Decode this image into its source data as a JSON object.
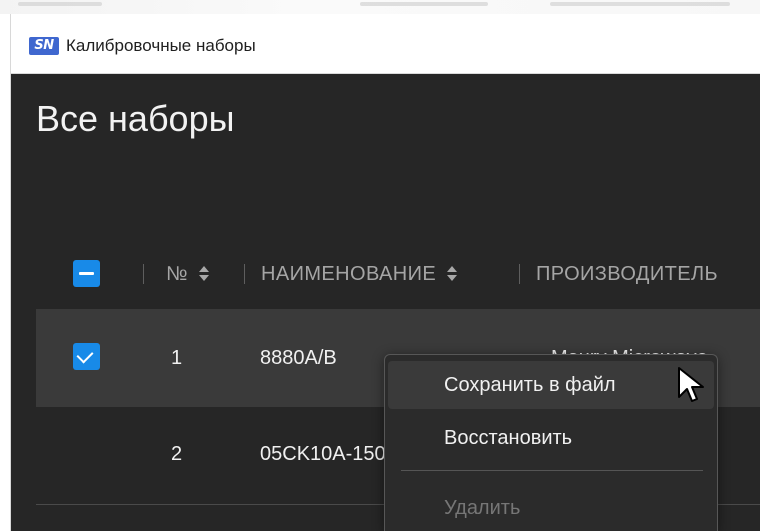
{
  "window": {
    "app_icon": "SN",
    "title": "Калибровочные наборы"
  },
  "page": {
    "title": "Все наборы"
  },
  "table": {
    "columns": [
      {
        "label": "№",
        "sortable": true
      },
      {
        "label": "НАИМЕНОВАНИЕ",
        "sortable": true
      },
      {
        "label": "ПРОИЗВОДИТЕЛЬ",
        "sortable": false
      }
    ],
    "header_checkbox_state": "indeterminate",
    "rows": [
      {
        "number": "1",
        "name": "8880A/B",
        "manufacturer": "Maury Microwave",
        "checked": true,
        "highlighted": true
      },
      {
        "number": "2",
        "name": "05CK10A-150",
        "manufacturer": "",
        "checked": false,
        "highlighted": false
      }
    ]
  },
  "context_menu": {
    "items": [
      {
        "label": "Сохранить в файл",
        "state": "hover"
      },
      {
        "label": "Восстановить",
        "state": "normal"
      },
      {
        "label": "Удалить",
        "state": "disabled"
      }
    ]
  },
  "cursor": {
    "icon": "mouse-pointer-icon"
  },
  "colors": {
    "accent": "#188ae8",
    "background": "#262626",
    "selected_row": "#3a3a3a",
    "menu_background": "#2b2b2b",
    "title_text": "#f2f2f2",
    "header_text": "#a5a5a5",
    "disabled_text": "#767676",
    "app_icon_background": "#3f67cf"
  }
}
